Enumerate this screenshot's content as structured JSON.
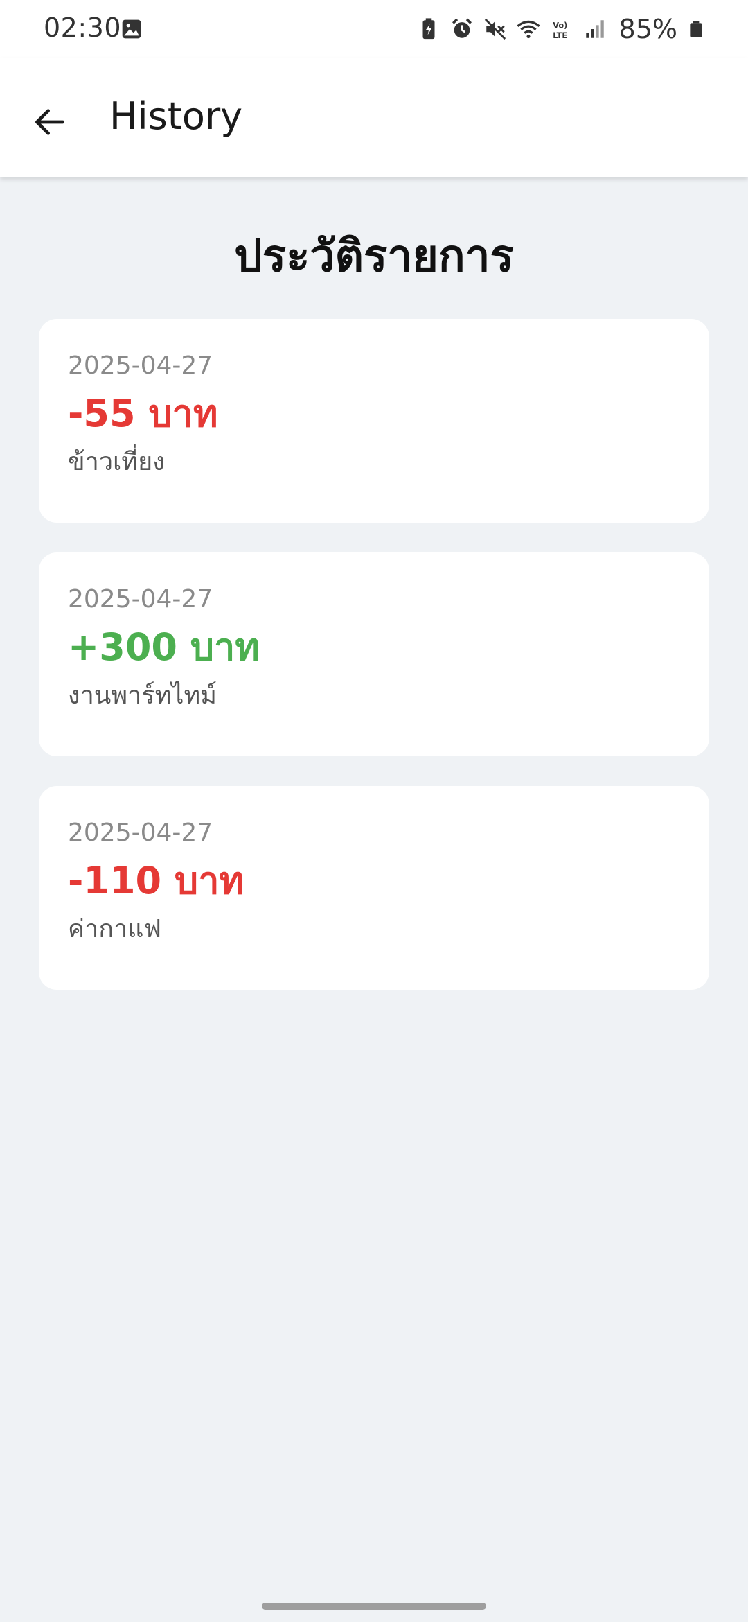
{
  "status_bar": {
    "time": "02:30",
    "battery_percent": "85%",
    "icons": [
      "gallery-icon",
      "battery-saver-icon",
      "alarm-icon",
      "mute-icon",
      "wifi-icon",
      "volte-icon",
      "signal-icon",
      "battery-icon"
    ]
  },
  "app_bar": {
    "title": "History",
    "back_icon": "arrow-left-icon"
  },
  "page": {
    "heading": "ประวัติรายการ"
  },
  "transactions": [
    {
      "date": "2025-04-27",
      "amount": "-55 บาท",
      "type": "expense",
      "note": "ข้าวเที่ยง"
    },
    {
      "date": "2025-04-27",
      "amount": "+300 บาท",
      "type": "income",
      "note": "งานพาร์ทไทม์"
    },
    {
      "date": "2025-04-27",
      "amount": "-110 บาท",
      "type": "expense",
      "note": "ค่ากาแฟ"
    }
  ],
  "colors": {
    "expense": "#e53935",
    "income": "#4caf50",
    "background": "#eff2f5",
    "card": "#ffffff"
  }
}
